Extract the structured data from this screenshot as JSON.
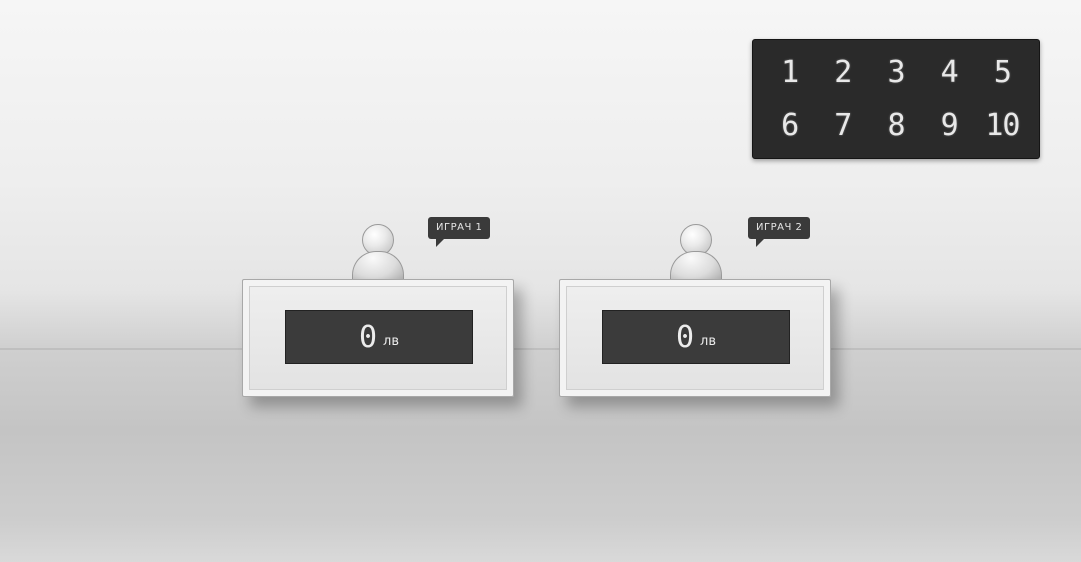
{
  "question_numbers": [
    "1",
    "2",
    "3",
    "4",
    "5",
    "6",
    "7",
    "8",
    "9",
    "10"
  ],
  "players": [
    {
      "name": "ИГРАЧ 1",
      "amount": "0",
      "currency": "лв"
    },
    {
      "name": "ИГРАЧ 2",
      "amount": "0",
      "currency": "лв"
    }
  ],
  "colors": {
    "board_bg": "#2a2a2a",
    "digit": "#e8e8e8",
    "screen_bg": "#3b3b3b",
    "podium": "#e8e8e8",
    "bubble_bg": "#3a3a3a"
  },
  "icons": {
    "player_avatar": "person-icon"
  }
}
